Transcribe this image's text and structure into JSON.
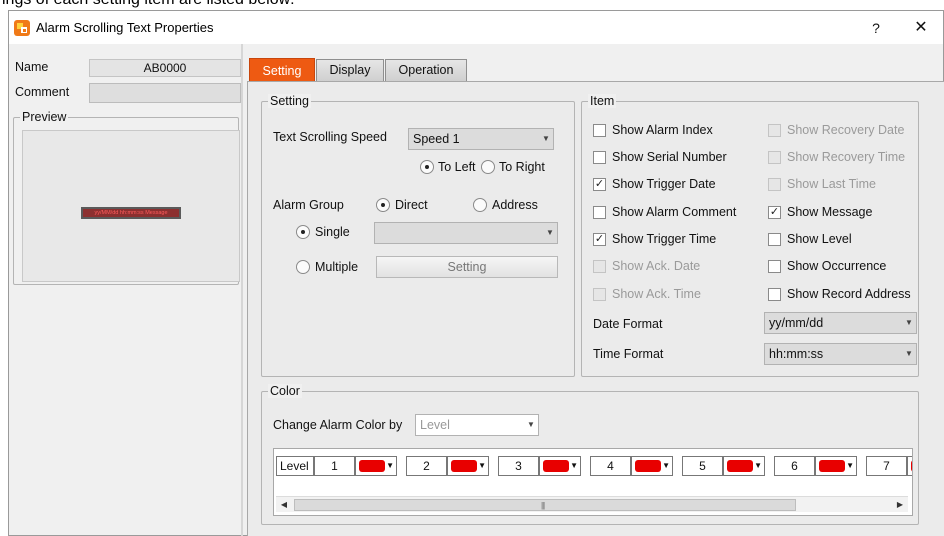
{
  "document": {
    "top_line_text": "ings of each setting item are listed below:"
  },
  "window": {
    "title": "Alarm Scrolling Text Properties",
    "help_label": "?",
    "close_label": "✕"
  },
  "left": {
    "name_label": "Name",
    "name_value": "AB0000",
    "comment_label": "Comment",
    "comment_value": "",
    "preview_label": "Preview",
    "preview_text": "yy/MM/dd hh:mm:ss Message"
  },
  "tabs": [
    {
      "label": "Setting",
      "active": true
    },
    {
      "label": "Display",
      "active": false
    },
    {
      "label": "Operation",
      "active": false
    }
  ],
  "setting": {
    "group_label": "Setting",
    "speed_label": "Text Scrolling Speed",
    "speed_value": "Speed 1",
    "to_left_label": "To Left",
    "to_right_label": "To Right",
    "direction_selected": "To Left",
    "alarm_group_label": "Alarm Group",
    "direct_label": "Direct",
    "address_label": "Address",
    "alarm_group_selected": "Direct",
    "single_label": "Single",
    "multiple_label": "Multiple",
    "mode_selected": "Single",
    "single_value": "",
    "setting_button_label": "Setting"
  },
  "item": {
    "group_label": "Item",
    "left_column": [
      {
        "label": "Show Alarm Index",
        "checked": false,
        "enabled": true
      },
      {
        "label": "Show Serial Number",
        "checked": false,
        "enabled": true
      },
      {
        "label": "Show Trigger Date",
        "checked": true,
        "enabled": true
      },
      {
        "label": "Show Alarm Comment",
        "checked": false,
        "enabled": true
      },
      {
        "label": "Show Trigger Time",
        "checked": true,
        "enabled": true
      },
      {
        "label": "Show Ack. Date",
        "checked": false,
        "enabled": false
      },
      {
        "label": "Show Ack. Time",
        "checked": false,
        "enabled": false
      }
    ],
    "right_column": [
      {
        "label": "Show Recovery Date",
        "checked": false,
        "enabled": false
      },
      {
        "label": "Show Recovery Time",
        "checked": false,
        "enabled": false
      },
      {
        "label": "Show Last Time",
        "checked": false,
        "enabled": false
      },
      {
        "label": "Show Message",
        "checked": true,
        "enabled": true
      },
      {
        "label": "Show Level",
        "checked": false,
        "enabled": true
      },
      {
        "label": "Show Occurrence",
        "checked": false,
        "enabled": true
      },
      {
        "label": "Show Record Address",
        "checked": false,
        "enabled": true
      }
    ],
    "date_format_label": "Date Format",
    "date_format_value": "yy/mm/dd",
    "time_format_label": "Time Format",
    "time_format_value": "hh:mm:ss"
  },
  "color": {
    "group_label": "Color",
    "change_by_label": "Change Alarm Color by",
    "change_by_value": "Level",
    "level_header": "Level",
    "levels": [
      "1",
      "2",
      "3",
      "4",
      "5",
      "6",
      "7"
    ],
    "level_color": "#e80000",
    "scroll_grip": "|||"
  },
  "icons": {
    "dropdown_arrow": "▼",
    "check_mark": "✓",
    "scroll_left": "◀",
    "scroll_right": "▶"
  }
}
